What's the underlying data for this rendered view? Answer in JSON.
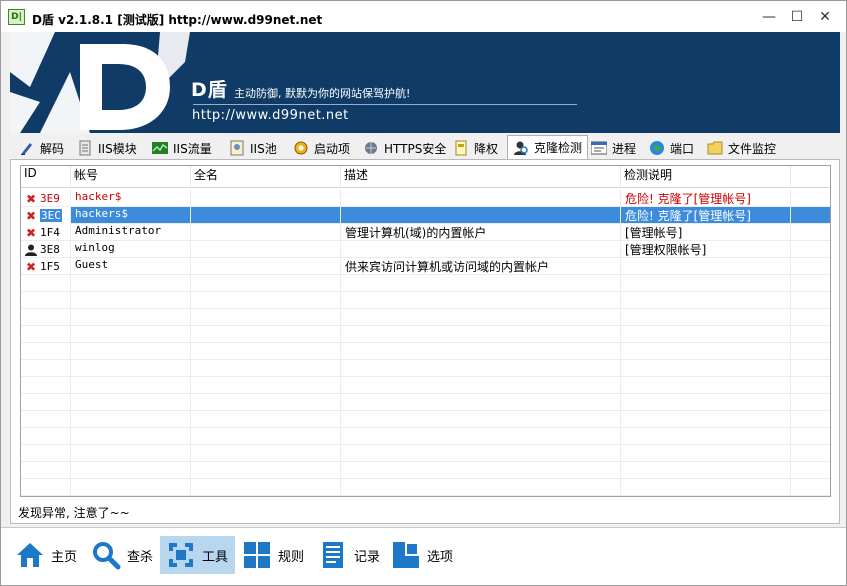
{
  "window": {
    "title": "D盾 v2.1.8.1 [测试版] http://www.d99net.net",
    "app_icon_text": "D|",
    "minimize": "—",
    "maximize": "☐",
    "close": "✕"
  },
  "banner": {
    "name": "D盾",
    "slogan": "主动防御, 默默为你的网站保驾护航!",
    "url": "http://www.d99net.net",
    "bg_color": "#0f3b66"
  },
  "tabs": [
    {
      "label": "解码",
      "icon": "decode-icon"
    },
    {
      "label": "IIS模块",
      "icon": "iis-module-icon"
    },
    {
      "label": "IIS流量",
      "icon": "iis-traffic-icon"
    },
    {
      "label": "IIS池",
      "icon": "iis-pool-icon"
    },
    {
      "label": "启动项",
      "icon": "startup-icon"
    },
    {
      "label": "HTTPS安全",
      "icon": "https-icon"
    },
    {
      "label": "降权",
      "icon": "downgrade-icon"
    },
    {
      "label": "克隆检测",
      "icon": "clone-detect-icon",
      "active": true
    },
    {
      "label": "进程",
      "icon": "process-icon"
    },
    {
      "label": "端口",
      "icon": "port-icon"
    },
    {
      "label": "文件监控",
      "icon": "file-monitor-icon"
    }
  ],
  "table": {
    "columns": [
      "ID",
      "帐号",
      "全名",
      "描述",
      "检测说明"
    ],
    "rows": [
      {
        "id": "3E9",
        "account": "hacker$",
        "fullname": "",
        "description": "",
        "note": "危险! 克隆了[管理帐号]",
        "icon": "x",
        "status": "danger"
      },
      {
        "id": "3EC",
        "account": "hackers$",
        "fullname": "",
        "description": "",
        "note": "危险! 克隆了[管理帐号]",
        "icon": "x",
        "status": "selected"
      },
      {
        "id": "1F4",
        "account": "Administrator",
        "fullname": "",
        "description": "管理计算机(域)的内置帐户",
        "note": "[管理帐号]",
        "icon": "x",
        "status": "normal"
      },
      {
        "id": "3E8",
        "account": "winlog",
        "fullname": "",
        "description": "",
        "note": "[管理权限帐号]",
        "icon": "user",
        "status": "normal"
      },
      {
        "id": "1F5",
        "account": "Guest",
        "fullname": "",
        "description": "供来宾访问计算机或访问域的内置帐户",
        "note": "",
        "icon": "x",
        "status": "normal"
      }
    ]
  },
  "status": "发现异常, 注意了~~",
  "nav": [
    {
      "label": "主页",
      "icon": "home-icon"
    },
    {
      "label": "查杀",
      "icon": "search-kill-icon"
    },
    {
      "label": "工具",
      "icon": "tools-icon",
      "active": true
    },
    {
      "label": "规则",
      "icon": "rules-icon"
    },
    {
      "label": "记录",
      "icon": "log-icon"
    },
    {
      "label": "选项",
      "icon": "options-icon"
    }
  ],
  "colors": {
    "selected_row": "#3c8cdb",
    "danger_text": "#cc0000",
    "nav_active": "#b9d6ef",
    "accent_blue": "#1e78c8"
  }
}
